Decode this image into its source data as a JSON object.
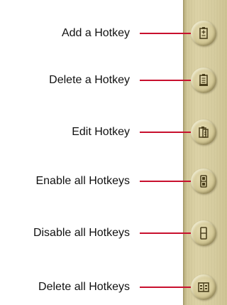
{
  "hotkey_toolbar": {
    "items": [
      {
        "label": "Add a Hotkey",
        "icon": "add-hotkey-icon"
      },
      {
        "label": "Delete a Hotkey",
        "icon": "delete-hotkey-icon"
      },
      {
        "label": "Edit Hotkey",
        "icon": "edit-hotkey-icon"
      },
      {
        "label": "Enable all Hotkeys",
        "icon": "enable-all-hotkeys-icon"
      },
      {
        "label": "Disable all Hotkeys",
        "icon": "disable-all-hotkeys-icon"
      },
      {
        "label": "Delete all Hotkeys",
        "icon": "delete-all-hotkeys-icon"
      }
    ]
  },
  "colors": {
    "leader_line": "#c8102e",
    "toolbar_background": "#d6cc9e",
    "icon_stroke": "#4a3f1c"
  }
}
